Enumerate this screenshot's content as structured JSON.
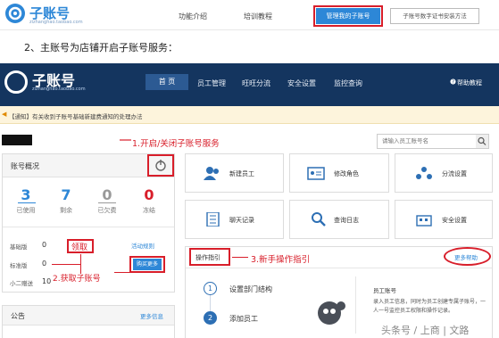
{
  "top_header": {
    "logo_text": "子账号",
    "logo_sub": "zizhanghao.taobao.com",
    "nav": [
      "功能介绍",
      "培训教程"
    ],
    "nav_active": "管理我的子账号",
    "nav_right": "子账号数字证书安装方法"
  },
  "instruction": "2、主账号为店铺开启子账号服务：",
  "banner": {
    "title": "子账号",
    "subtitle": "zizhanghao.taobao.com",
    "nav": [
      "首 页",
      "员工管理",
      "旺旺分流",
      "安全设置",
      "监控查询"
    ],
    "help": "帮助教程"
  },
  "notice": "【通知】有关收到子账号基础新建费通知的处理办法",
  "annotations": {
    "step1": "1.开启/关闭子账号服务",
    "get": "领取",
    "step2": "2.获取子账号",
    "step3": "3.新手操作指引"
  },
  "search": {
    "placeholder": "请输入员工账号名"
  },
  "overview": {
    "title": "账号概况",
    "stats": [
      {
        "value": "3",
        "label": "已使用",
        "color": "#2d87d7"
      },
      {
        "value": "7",
        "label": "剩余",
        "color": "#2d87d7"
      },
      {
        "value": "0",
        "label": "已欠费",
        "color": "#999999"
      },
      {
        "value": "0",
        "label": "冻结",
        "color": "#d81e2a"
      }
    ],
    "quota_rows": [
      {
        "label": "基础版",
        "value": "0"
      },
      {
        "label": "标准版",
        "value": "0"
      },
      {
        "label": "小二赠送",
        "value": "10"
      }
    ],
    "activity_rule": "活动规则",
    "buy_more": "购买更多"
  },
  "announcement": {
    "title": "公告",
    "more": "更多信息"
  },
  "tiles": [
    {
      "label": "新建员工",
      "icon": "add-user-icon"
    },
    {
      "label": "修改角色",
      "icon": "edit-role-icon"
    },
    {
      "label": "分流设置",
      "icon": "distribution-icon"
    },
    {
      "label": "聊天记录",
      "icon": "chat-log-icon"
    },
    {
      "label": "查询日志",
      "icon": "search-log-icon"
    },
    {
      "label": "安全设置",
      "icon": "security-icon"
    }
  ],
  "guide": {
    "title": "操作指引",
    "more_help": "更多帮助",
    "steps": [
      {
        "num": "1",
        "label": "设置部门结构"
      },
      {
        "num": "2",
        "label": "添加员工"
      }
    ],
    "info_title": "员工账号",
    "info_text": "录入员工信息，同时为员工创建专属子账号，一人一号监控员工权限和操作记录。"
  },
  "watermark": "头条号 / 上商 | 文路",
  "colors": {
    "brand_blue": "#2d87d7",
    "banner_navy": "#14355f",
    "annotation_red": "#d81e2a"
  }
}
